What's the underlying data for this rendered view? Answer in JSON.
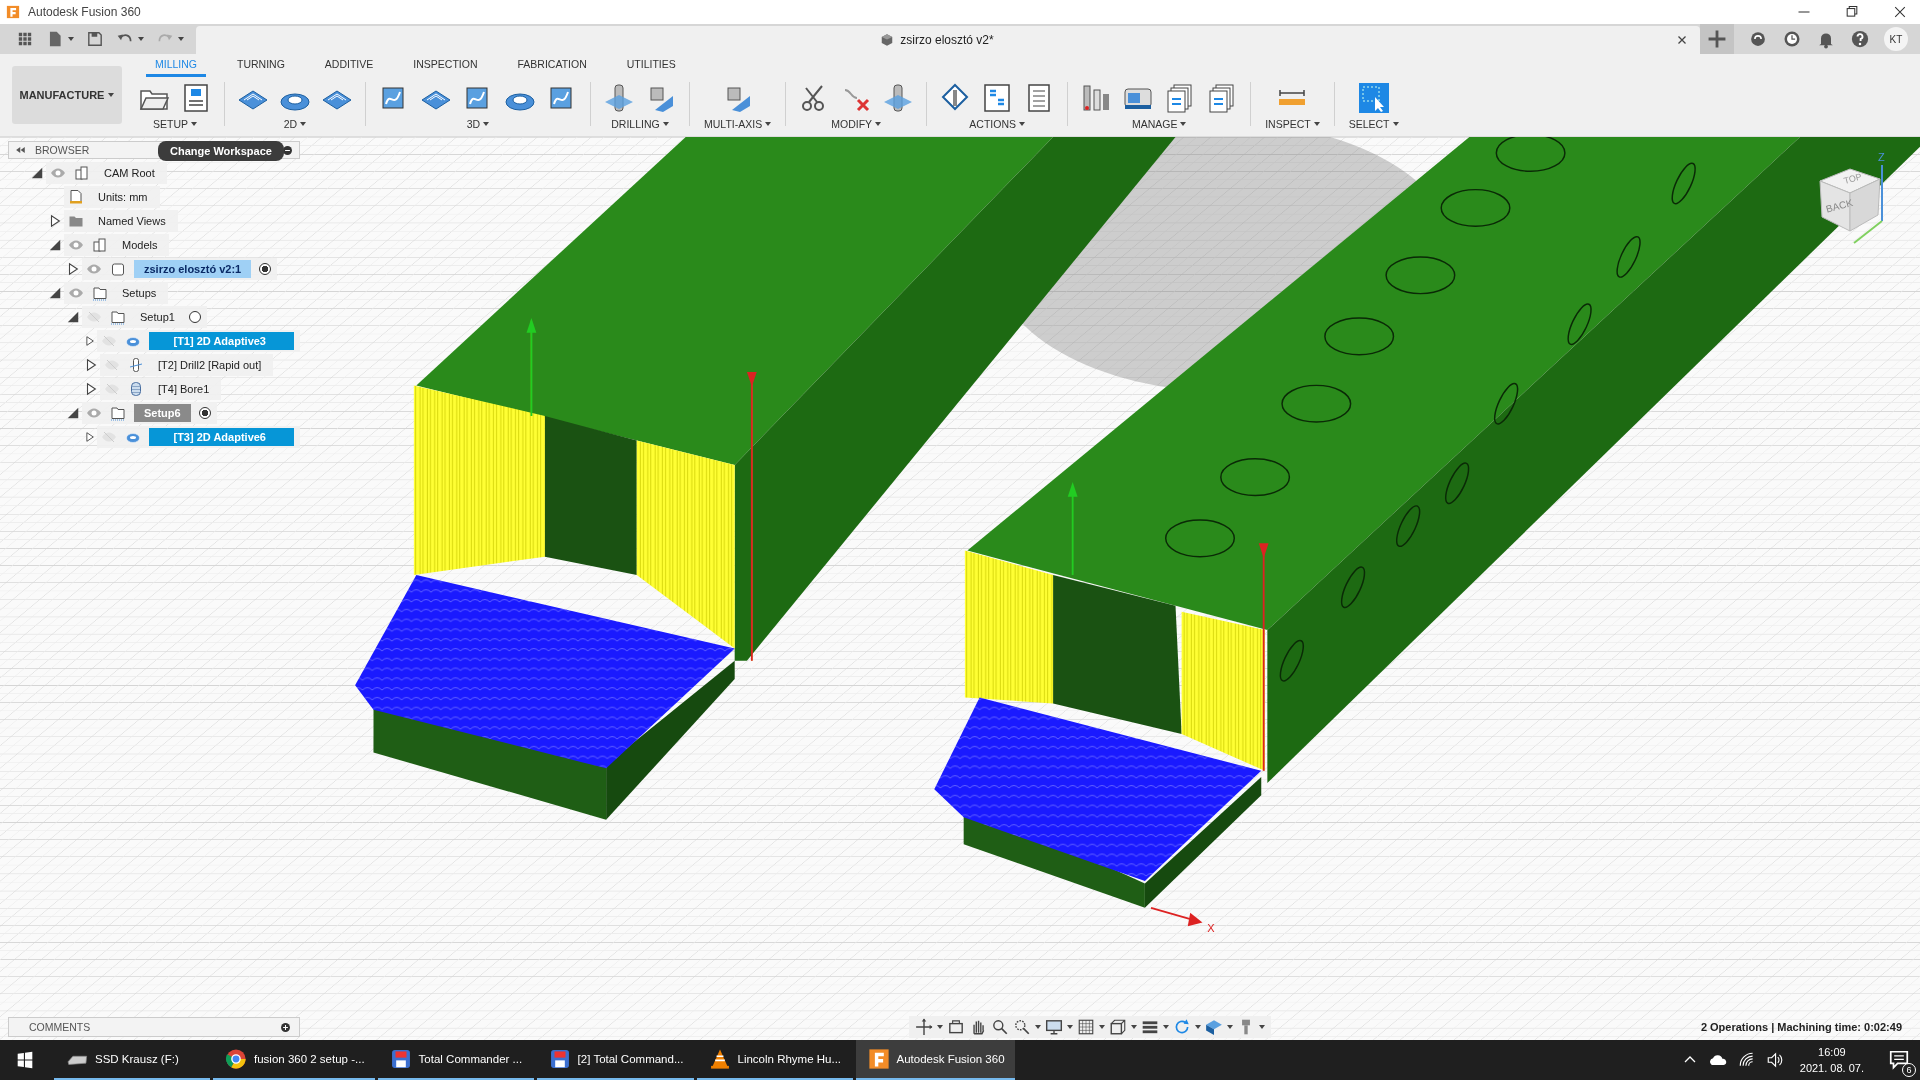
{
  "window": {
    "title": "Autodesk Fusion 360"
  },
  "document_tab": {
    "title": "zsirzo elosztó v2*"
  },
  "user": {
    "initials": "KT"
  },
  "workspace": {
    "label": "MANUFACTURE"
  },
  "tabs": [
    {
      "label": "MILLING",
      "selected": true
    },
    {
      "label": "TURNING",
      "selected": false
    },
    {
      "label": "ADDITIVE",
      "selected": false
    },
    {
      "label": "INSPECTION",
      "selected": false
    },
    {
      "label": "FABRICATION",
      "selected": false
    },
    {
      "label": "UTILITIES",
      "selected": false
    }
  ],
  "ribbon_groups": [
    {
      "label": "SETUP",
      "kind": "setup"
    },
    {
      "label": "2D",
      "kind": "twod"
    },
    {
      "label": "3D",
      "kind": "threed"
    },
    {
      "label": "DRILLING",
      "kind": "drilling"
    },
    {
      "label": "MULTI-AXIS",
      "kind": "multiaxis"
    },
    {
      "label": "MODIFY",
      "kind": "modify"
    },
    {
      "label": "ACTIONS",
      "kind": "actions"
    },
    {
      "label": "MANAGE",
      "kind": "manage"
    },
    {
      "label": "INSPECT",
      "kind": "inspect"
    },
    {
      "label": "SELECT",
      "kind": "select"
    }
  ],
  "tooltip": "Change Workspace",
  "browser": {
    "title": "BROWSER",
    "tree": [
      {
        "label": "CAM Root",
        "kind": "root",
        "expanded": true,
        "visible": true,
        "children": [
          {
            "label": "Units: mm",
            "kind": "units"
          },
          {
            "label": "Named Views",
            "kind": "folder",
            "expanded": false
          },
          {
            "label": "Models",
            "kind": "models",
            "expanded": true,
            "visible": true,
            "children": [
              {
                "label": "zsirzo elosztó v2:1",
                "kind": "model",
                "expanded": false,
                "visible": true,
                "active": true
              }
            ]
          },
          {
            "label": "Setups",
            "kind": "setups",
            "expanded": true,
            "visible": true,
            "children": [
              {
                "label": "Setup1",
                "kind": "setup",
                "expanded": true,
                "visible": false,
                "active": false,
                "children": [
                  {
                    "label": "[T1] 2D Adaptive3",
                    "kind": "adaptive",
                    "expanded": false,
                    "visible": false,
                    "selected": true
                  },
                  {
                    "label": "[T2] Drill2 [Rapid out]",
                    "kind": "drill",
                    "expanded": false,
                    "visible": false,
                    "selected": false
                  },
                  {
                    "label": "[T4] Bore1",
                    "kind": "bore",
                    "expanded": false,
                    "visible": false,
                    "selected": false
                  }
                ]
              },
              {
                "label": "Setup6",
                "kind": "setup",
                "expanded": true,
                "visible": true,
                "active": true,
                "children": [
                  {
                    "label": "[T3] 2D Adaptive6",
                    "kind": "adaptive",
                    "expanded": false,
                    "visible": false,
                    "selected": true
                  }
                ]
              }
            ]
          }
        ]
      }
    ]
  },
  "viewcube": {
    "faces": [
      "TOP",
      "BACK"
    ],
    "axis_label": "Z"
  },
  "scene": {
    "axis_label": "X"
  },
  "comments": {
    "title": "COMMENTS"
  },
  "status": "2 Operations | Machining time: 0:02:49",
  "taskbar": {
    "items": [
      {
        "label": "SSD Krausz (F:)",
        "kind": "drive",
        "selected": false
      },
      {
        "label": "fusion 360 2 setup -...",
        "kind": "browser",
        "selected": false
      },
      {
        "label": "Total Commander ...",
        "kind": "files",
        "selected": false
      },
      {
        "label": "[2] Total Command...",
        "kind": "files",
        "selected": false
      },
      {
        "label": "Lincoln Rhyme Hu...",
        "kind": "player",
        "selected": false
      },
      {
        "label": "Autodesk Fusion 360",
        "kind": "app",
        "selected": true
      }
    ],
    "time": "16:09",
    "date": "2021. 08. 07.",
    "notifications": "6"
  }
}
